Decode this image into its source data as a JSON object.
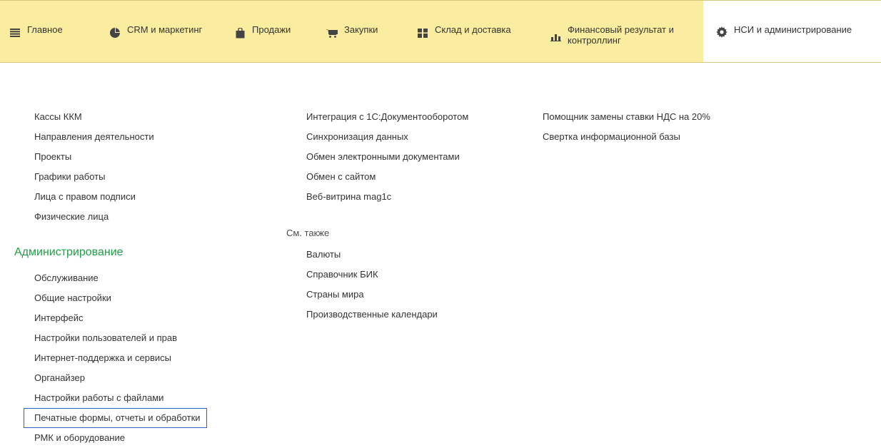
{
  "topnav": {
    "tabs": [
      {
        "label": "Главное",
        "icon": "menu-icon"
      },
      {
        "label": "CRM и маркетинг",
        "icon": "pie-chart-icon"
      },
      {
        "label": "Продажи",
        "icon": "shopping-bag-icon"
      },
      {
        "label": "Закупки",
        "icon": "cart-icon"
      },
      {
        "label": "Склад и доставка",
        "icon": "warehouse-icon"
      },
      {
        "label": "Финансовый результат и контроллинг",
        "icon": "bar-chart-icon"
      },
      {
        "label": "НСИ и администрирование",
        "icon": "gear-icon"
      }
    ],
    "active_tab": "НСИ и администрирование",
    "colors": {
      "bar_bg": "#fbeda0",
      "active_bg": "#ffffff",
      "section_title": "#1f9e48",
      "focus_outline": "#2e64c4"
    }
  },
  "col1": {
    "items": [
      "Кассы ККМ",
      "Направления деятельности",
      "Проекты",
      "Графики работы",
      "Лица с правом подписи",
      "Физические лица"
    ],
    "admin_title": "Администрирование",
    "admin_items": [
      "Обслуживание",
      "Общие настройки",
      "Интерфейс",
      "Настройки пользователей и прав",
      "Интернет-поддержка и сервисы",
      "Органайзер",
      "Настройки работы с файлами",
      "Печатные формы, отчеты и обработки",
      "РМК и оборудование"
    ]
  },
  "col2": {
    "items": [
      "Интеграция с 1С:Документооборотом",
      "Синхронизация данных",
      "Обмен электронными документами",
      "Обмен с сайтом",
      "Веб-витрина mag1c"
    ],
    "see_also_title": "См. также",
    "see_also_items": [
      "Валюты",
      "Справочник БИК",
      "Страны мира",
      "Производственные календари"
    ]
  },
  "col3": {
    "items": [
      "Помощник замены ставки НДС на 20%",
      "Свертка информационной базы"
    ]
  }
}
